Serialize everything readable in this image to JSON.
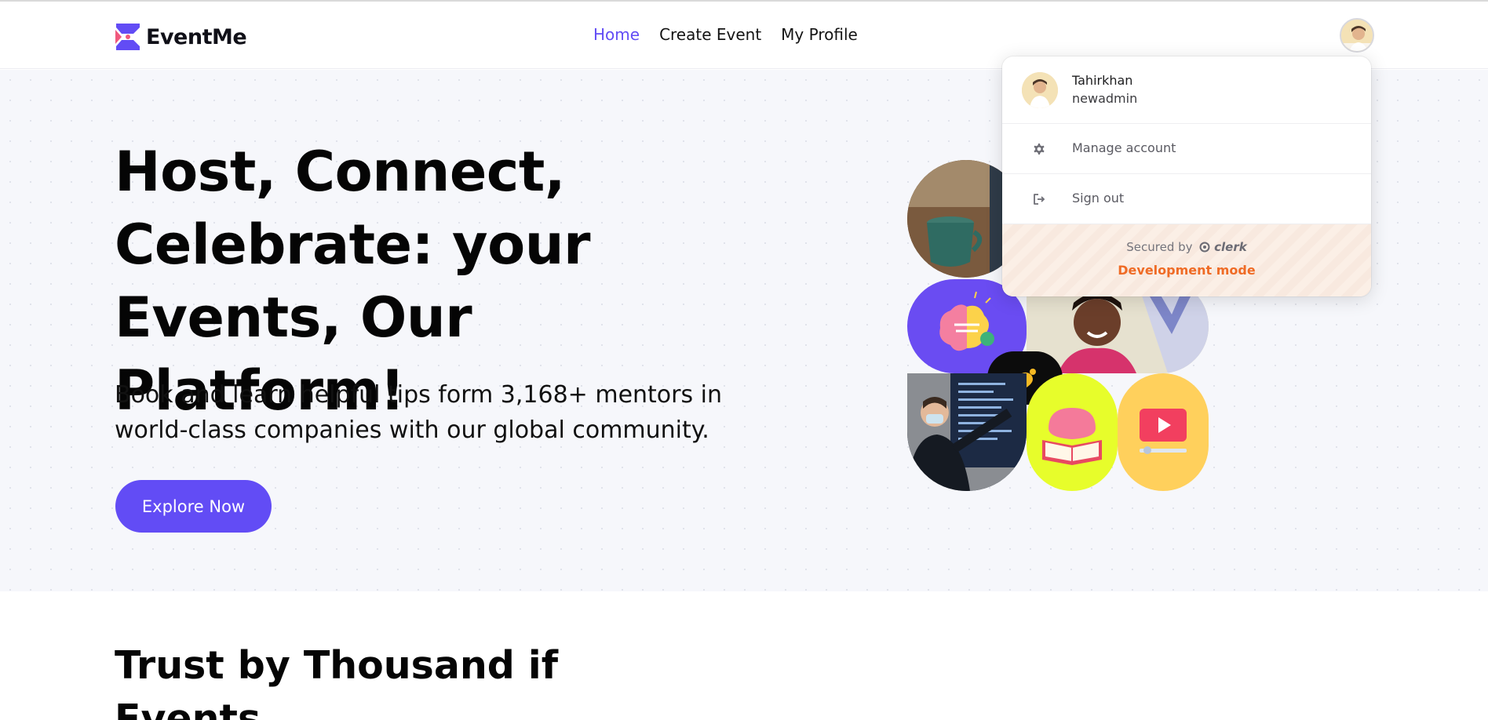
{
  "brand": {
    "name": "EventMe",
    "accent": "#624cf5",
    "logo_colors": [
      "#624cf5",
      "#f0587d"
    ]
  },
  "nav": {
    "items": [
      {
        "label": "Home",
        "active": true
      },
      {
        "label": "Create Event",
        "active": false
      },
      {
        "label": "My Profile",
        "active": false
      }
    ]
  },
  "hero": {
    "title": "Host, Connect, Celebrate: your Events, Our Platform!",
    "subtitle": "Book and learn helpful tips form 3,168+ mentors in world-class companies with our global community.",
    "cta_label": "Explore Now",
    "background": "#f6f7fb"
  },
  "trust": {
    "heading": "Trust by Thousand if Events"
  },
  "user_menu": {
    "display_name": "Tahirkhan",
    "username": "newadmin",
    "items": [
      {
        "label": "Manage account",
        "icon": "gear-icon"
      },
      {
        "label": "Sign out",
        "icon": "sign-out-icon"
      }
    ],
    "secured_by": "Secured by",
    "provider": "clerk",
    "mode_label": "Development mode",
    "mode_color": "#ef6b25"
  }
}
